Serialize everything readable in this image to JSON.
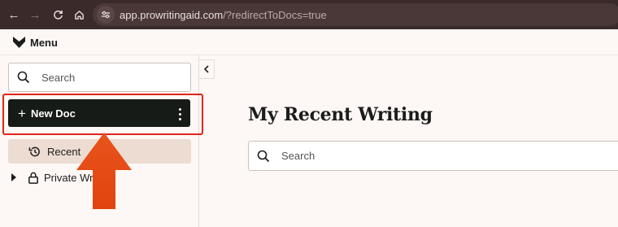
{
  "browser": {
    "url_host": "app.prowritingaid.com",
    "url_path": "/?redirectToDocs=true"
  },
  "header": {
    "menu_label": "Menu"
  },
  "sidebar": {
    "search_placeholder": "Search",
    "new_doc_label": "New Doc",
    "items": [
      {
        "label": "Recent",
        "icon": "history-icon",
        "active": true
      },
      {
        "label": "Private Writ",
        "icon": "lock-icon",
        "expandable": true
      }
    ]
  },
  "main": {
    "title": "My Recent Writing",
    "search_placeholder": "Search"
  },
  "annotation": {
    "highlight_color": "#e0261a",
    "arrow_color": "#e8531c"
  },
  "colors": {
    "button_bg": "#161b17",
    "active_item_bg": "#ecdcd2",
    "page_bg": "#fdf8f5"
  }
}
